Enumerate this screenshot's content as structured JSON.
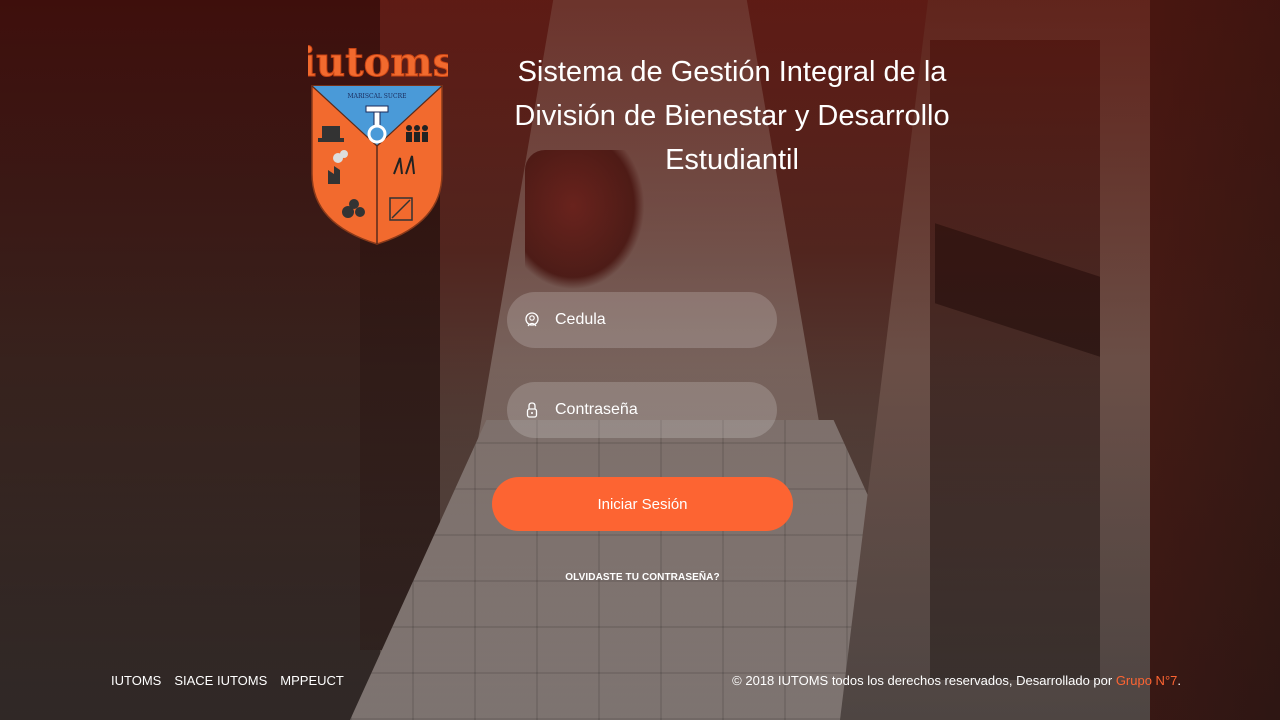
{
  "header": {
    "title": "Sistema de Gestión Integral de la División de Bienestar y Desarrollo Estudiantil",
    "logo_text": "iutoms",
    "logo_subtitle": "MARISCAL SUCRE"
  },
  "login": {
    "username_placeholder": "Cedula",
    "password_placeholder": "Contraseña",
    "submit_label": "Iniciar Sesión",
    "forgot_label": "OLVIDASTE TU CONTRASEÑA?",
    "username_icon": "user-circle-icon",
    "password_icon": "lock-icon"
  },
  "footer": {
    "links": [
      "IUTOMS",
      "SIACE IUTOMS",
      "MPPEUCT"
    ],
    "copyright_text": "© 2018 IUTOMS todos los derechos reservados, Desarrollado por ",
    "developer_link": "Grupo N°7",
    "copyright_end": "."
  },
  "colors": {
    "accent": "#fd6432",
    "shield_blue": "#4a9ad8",
    "shield_orange": "#f26a2e"
  }
}
